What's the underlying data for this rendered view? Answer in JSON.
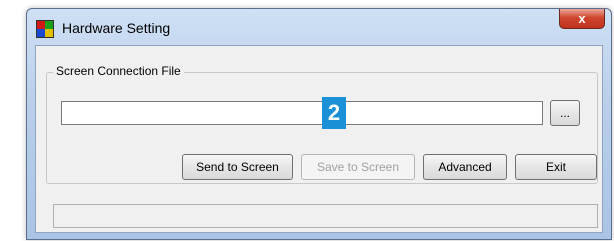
{
  "window": {
    "title": "Hardware Setting",
    "close_label": "x"
  },
  "group": {
    "legend": "Screen Connection File"
  },
  "path_input": {
    "value": ""
  },
  "badge": {
    "label": "2"
  },
  "buttons": {
    "browse": "...",
    "send": "Send to Screen",
    "save": "Save to Screen",
    "advanced": "Advanced",
    "exit": "Exit"
  },
  "status": {
    "text": ""
  },
  "colors": {
    "badge": "#1a90d6",
    "close": "#c0311c"
  }
}
